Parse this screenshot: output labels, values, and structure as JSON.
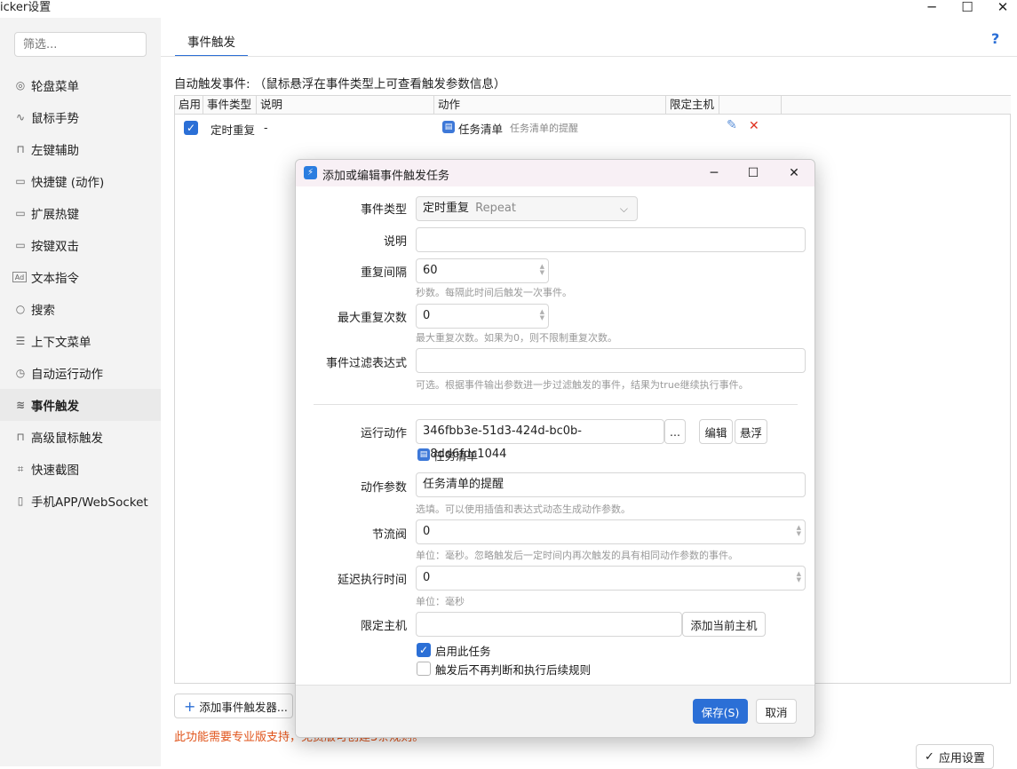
{
  "window": {
    "title": "icker设置"
  },
  "sidebar": {
    "search_placeholder": "筛选...",
    "items": [
      {
        "label": "轮盘菜单",
        "icon": "wheel-icon"
      },
      {
        "label": "鼠标手势",
        "icon": "gesture-icon"
      },
      {
        "label": "左键辅助",
        "icon": "mouse-icon"
      },
      {
        "label": "快捷键 (动作)",
        "icon": "keyboard-icon"
      },
      {
        "label": "扩展热键",
        "icon": "keyboard-icon"
      },
      {
        "label": "按键双击",
        "icon": "keyboard-icon"
      },
      {
        "label": "文本指令",
        "icon": "text-ad-icon"
      },
      {
        "label": "搜索",
        "icon": "search-icon"
      },
      {
        "label": "上下文菜单",
        "icon": "menu-icon"
      },
      {
        "label": "自动运行动作",
        "icon": "alarm-icon"
      },
      {
        "label": "事件触发",
        "icon": "trigger-icon"
      },
      {
        "label": "高级鼠标触发",
        "icon": "mouse-icon"
      },
      {
        "label": "快速截图",
        "icon": "screenshot-icon"
      },
      {
        "label": "手机APP/WebSocket",
        "icon": "phone-icon"
      }
    ]
  },
  "main": {
    "tab_label": "事件触发",
    "help": "?",
    "auto_trigger_label": "自动触发事件: （鼠标悬浮在事件类型上可查看触发参数信息）",
    "grid": {
      "headers": [
        "启用",
        "事件类型",
        "说明",
        "动作",
        "限定主机"
      ],
      "rows": [
        {
          "type": "定时重复",
          "desc": "-",
          "action_name": "任务清单",
          "action_param": "任务清单的提醒"
        }
      ]
    },
    "add_trigger_label": "添加事件触发器...",
    "pro_note": "此功能需要专业版支持，免费版可创建3条规则。",
    "apply_label": "应用设置"
  },
  "dialog": {
    "title": "添加或编辑事件触发任务",
    "event_type_label": "事件类型",
    "event_type_value": "定时重复",
    "event_type_sub": "Repeat",
    "desc_label": "说明",
    "desc_value": "",
    "interval_label": "重复间隔",
    "interval_value": "60",
    "interval_hint": "秒数。每隔此时间后触发一次事件。",
    "max_repeat_label": "最大重复次数",
    "max_repeat_value": "0",
    "max_repeat_hint": "最大重复次数。如果为0，则不限制重复次数。",
    "filter_label": "事件过滤表达式",
    "filter_value": "",
    "filter_hint": "可选。根据事件输出参数进一步过滤触发的事件，结果为true继续执行事件。",
    "run_action_label": "运行动作",
    "run_action_value": "346fbb3e-51d3-424d-bc0b-08dd6fdc1044",
    "dots_label": "...",
    "edit_label": "编辑",
    "float_label": "悬浮",
    "action_name": "任务清单",
    "action_param_label": "动作参数",
    "action_param_value": "任务清单的提醒",
    "action_param_hint": "选填。可以使用插值和表达式动态生成动作参数。",
    "throttle_label": "节流阀",
    "throttle_value": "0",
    "throttle_hint": "单位：毫秒。忽略触发后一定时间内再次触发的具有相同动作参数的事件。",
    "delay_label": "延迟执行时间",
    "delay_value": "0",
    "delay_hint": "单位：毫秒",
    "host_label": "限定主机",
    "host_value": "",
    "add_host_label": "添加当前主机",
    "enable_task_label": "启用此任务",
    "stop_after_label": "触发后不再判断和执行后续规则",
    "save_label": "保存(S)",
    "cancel_label": "取消"
  },
  "colors": {
    "accent": "#2b6fd6",
    "warning": "#e0541b",
    "delete": "#e0301e"
  }
}
